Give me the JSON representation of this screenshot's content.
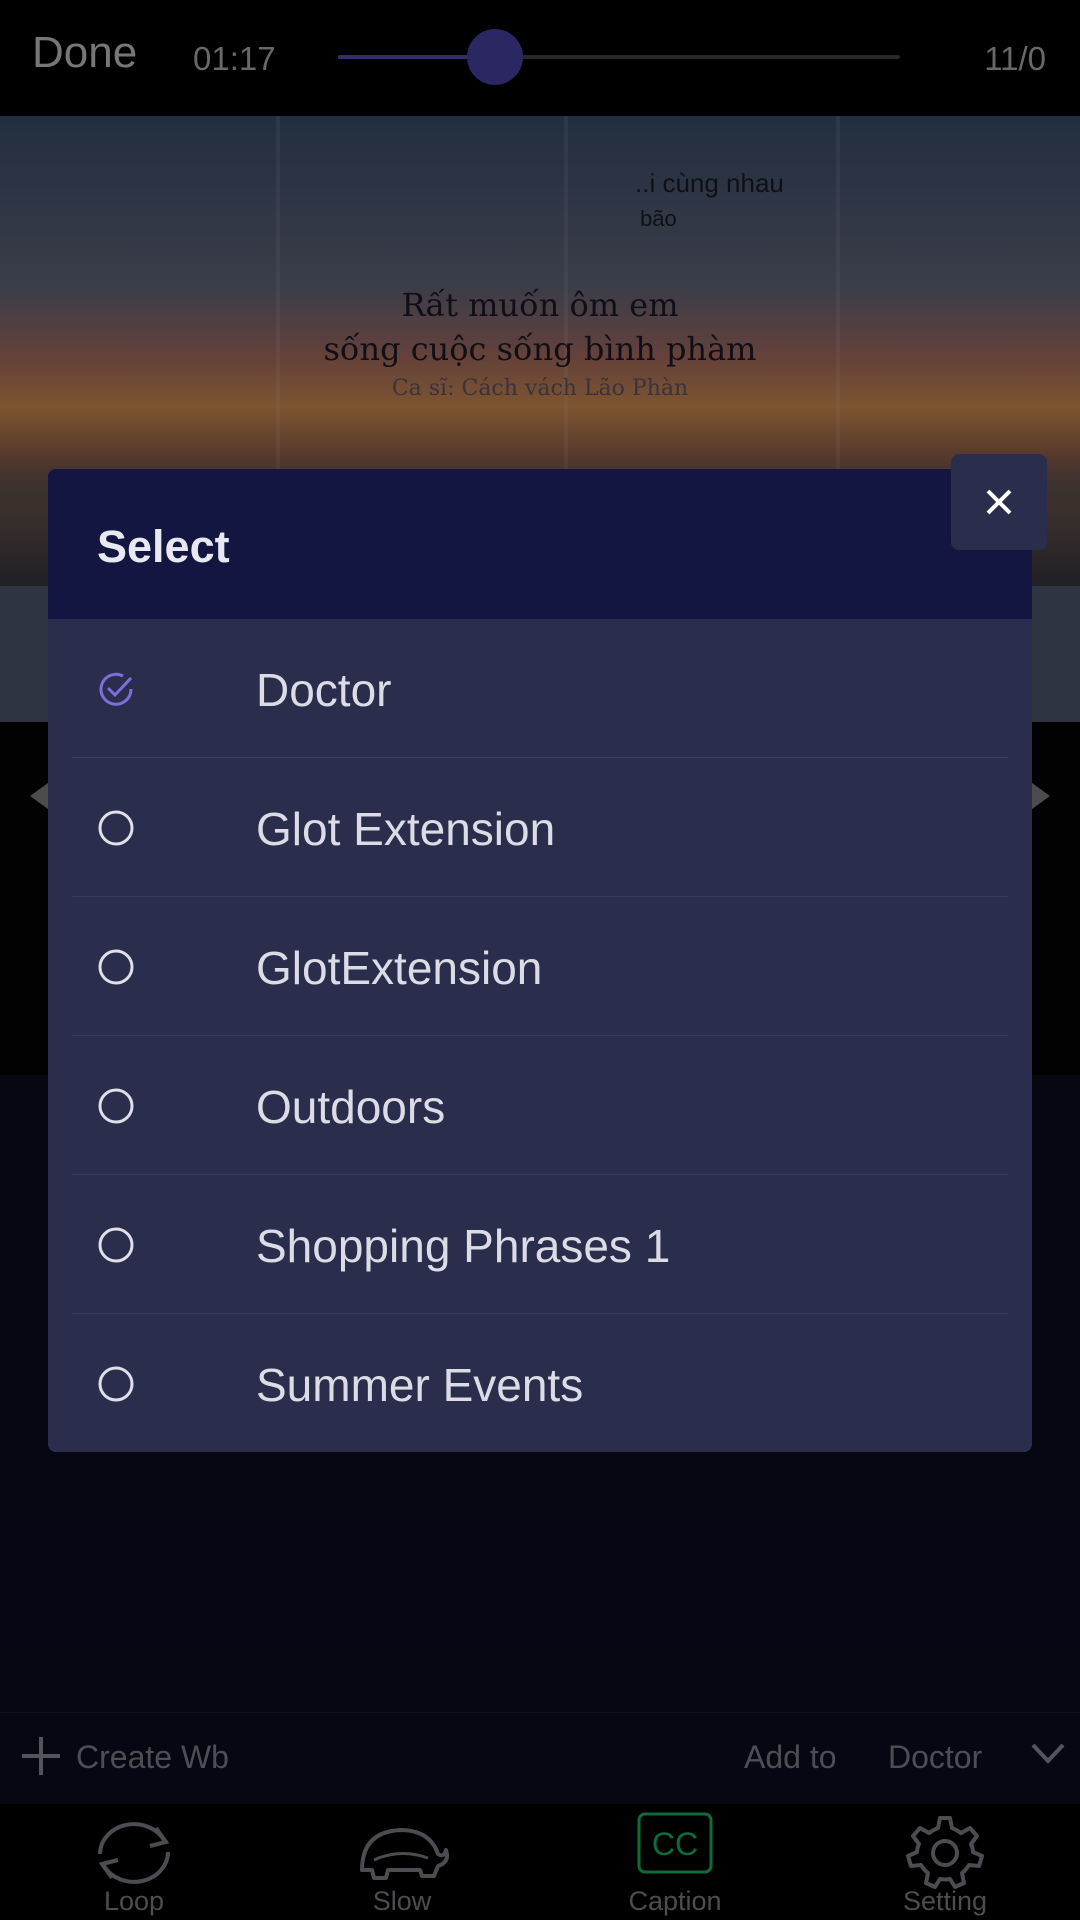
{
  "player": {
    "done_label": "Done",
    "time": "01:17",
    "counter": "11/0",
    "progress": 0.28
  },
  "video": {
    "lyric_top_1": "..i cùng nhau",
    "lyric_top_2": "bão",
    "lyric_line_1": "Rất muốn ôm em",
    "lyric_line_2": "sống cuộc sống bình phàm",
    "lyric_line_3": "Ca sĩ:  Cách vách Lão Phàn"
  },
  "modal": {
    "title": "Select",
    "selected_index": 0,
    "options": [
      {
        "label": "Doctor",
        "selected": true
      },
      {
        "label": "Glot Extension",
        "selected": false
      },
      {
        "label": "GlotExtension",
        "selected": false
      },
      {
        "label": "Outdoors",
        "selected": false
      },
      {
        "label": "Shopping Phrases 1",
        "selected": false
      },
      {
        "label": "Summer Events",
        "selected": false
      }
    ]
  },
  "toolbar": {
    "create_label": "Create Wb",
    "add_to_label": "Add to",
    "target_label": "Doctor"
  },
  "nav": {
    "loop": "Loop",
    "slow": "Slow",
    "caption": "Caption",
    "setting": "Setting"
  },
  "colors": {
    "accent": "#7b6fe0",
    "caption_active": "#1ec46a",
    "modal_header": "#131640",
    "modal_body": "#2b2d4c"
  },
  "icons": {
    "close": "close-icon",
    "check": "check-circle-icon",
    "radio": "radio-empty-icon",
    "plus": "plus-icon",
    "chevron": "chevron-down-icon",
    "loop": "loop-icon",
    "slow": "turtle-icon",
    "caption": "cc-icon",
    "setting": "gear-icon"
  }
}
